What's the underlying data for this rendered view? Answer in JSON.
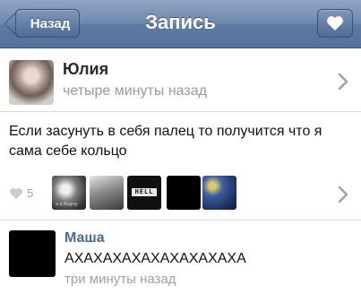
{
  "navbar": {
    "back_label": "Назад",
    "title": "Запись",
    "heart_icon": "heart-icon"
  },
  "post": {
    "author_name": "Юлия",
    "author_time": "четыре минуты назад",
    "text": "Если засунуть в себя палец то получится что я сама себе кольцо",
    "likes_count": "5",
    "attachment_3_label": "HELL",
    "attachment_1_caption": "x.x.Kugny"
  },
  "comment": {
    "author_name": "Маша",
    "text": "АХАХАХАХАХАХАХАХАХА",
    "time": "три минуты назад"
  },
  "colors": {
    "navbar": "#6d88ad",
    "comment_name": "#4a6a95"
  }
}
